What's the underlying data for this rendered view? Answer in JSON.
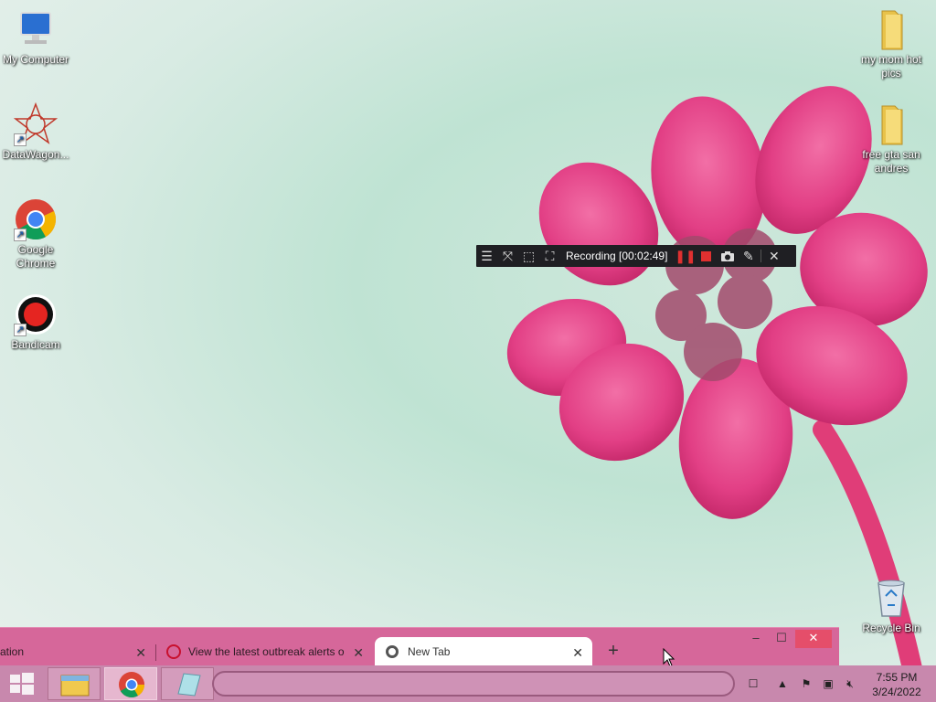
{
  "desktop": {
    "left_icons": [
      {
        "label": "My Computer",
        "icon": "computer-icon"
      },
      {
        "label": "DataWagon...",
        "icon": "datawagon-icon"
      },
      {
        "label": "Google Chrome",
        "icon": "chrome-icon"
      },
      {
        "label": "Bandicam",
        "icon": "bandicam-icon"
      }
    ],
    "right_icons": [
      {
        "label": "my mom hot pics",
        "icon": "folder-icon"
      },
      {
        "label": "free gta san andres",
        "icon": "folder-icon"
      },
      {
        "label": "Recycle Bin",
        "icon": "recycle-bin-icon"
      }
    ]
  },
  "recorder": {
    "status": "Recording [00:02:49]",
    "buttons": [
      "menu-icon",
      "resize-icon",
      "region-icon",
      "fullscreen-icon",
      "pause-icon",
      "stop-icon",
      "camera-icon",
      "pencil-icon",
      "close-icon"
    ],
    "accent": "#e03030"
  },
  "browser": {
    "tabs": [
      {
        "title": "ation",
        "active": false
      },
      {
        "title": "View the latest outbreak alerts o",
        "active": false
      },
      {
        "title": "New Tab",
        "active": true
      }
    ],
    "new_tab_label": "+",
    "frame_color": "#d6679a"
  },
  "taskbar": {
    "clock_time": "7:55 PM",
    "clock_date": "3/24/2022",
    "pinned": [
      "file-explorer-icon",
      "chrome-icon",
      "notepad-icon"
    ],
    "color": "#c888ad"
  }
}
